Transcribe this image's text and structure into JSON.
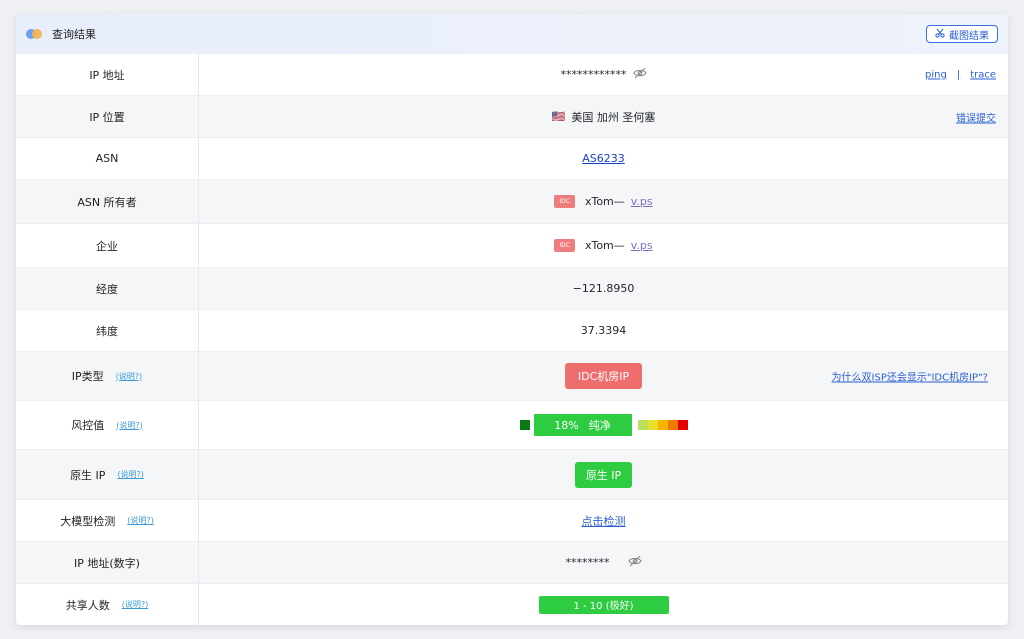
{
  "header": {
    "title": "查询结果",
    "screenshot_button": "截图结果",
    "screenshot_icon": "scissors-icon"
  },
  "rows": {
    "ip": {
      "label": "IP 地址",
      "value": "************",
      "links": [
        "ping",
        "trace"
      ],
      "separator": "|"
    },
    "location": {
      "label": "IP 位置",
      "flag": "🇺🇸",
      "value": "美国 加州 圣何塞",
      "link": "错误提交"
    },
    "asn": {
      "label": "ASN",
      "value": "AS6233"
    },
    "asn_owner": {
      "label": "ASN 所有者",
      "tag": "IDC",
      "name": "xTom—",
      "domain": "v.ps"
    },
    "company": {
      "label": "企业",
      "tag": "IDC",
      "name": "xTom—",
      "domain": "v.ps"
    },
    "longitude": {
      "label": "经度",
      "value": "−121.8950"
    },
    "latitude": {
      "label": "纬度",
      "value": "37.3394"
    },
    "ip_type": {
      "label": "IP类型",
      "help": "(说明?)",
      "value": "IDC机房IP",
      "link": "为什么双ISP还会显示\"IDC机房IP\"?"
    },
    "risk": {
      "label": "风控值",
      "help": "(说明?)",
      "percent": "18%",
      "value": "纯净",
      "scale_colors": [
        "#b8e05a",
        "#e8e02a",
        "#f5b400",
        "#f07a00",
        "#e80000"
      ]
    },
    "native": {
      "label": "原生 IP",
      "help": "(说明?)",
      "value": "原生 IP"
    },
    "llm": {
      "label": "大模型检测",
      "help": "(说明?)",
      "value": "点击检测"
    },
    "ip_numeric": {
      "label": "IP 地址(数字)",
      "value": "********"
    },
    "sharing": {
      "label": "共享人数",
      "help": "(说明?)",
      "value": "1 - 10 (极好)"
    }
  }
}
